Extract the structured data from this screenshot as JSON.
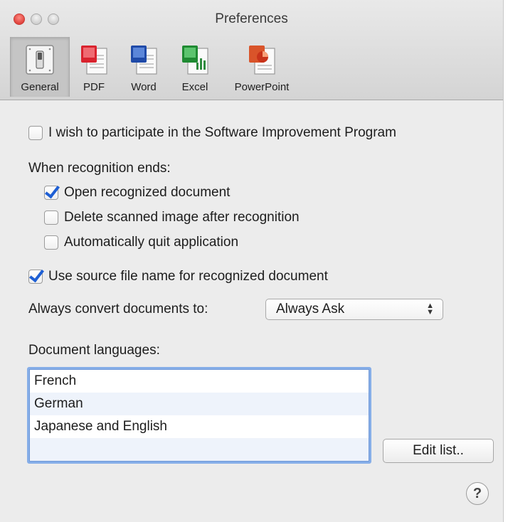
{
  "window": {
    "title": "Preferences"
  },
  "toolbar": {
    "tabs": [
      {
        "label": "General",
        "icon": "light-switch-icon",
        "selected": true
      },
      {
        "label": "PDF",
        "icon": "pdf-document-icon",
        "selected": false
      },
      {
        "label": "Word",
        "icon": "word-document-icon",
        "selected": false
      },
      {
        "label": "Excel",
        "icon": "excel-document-icon",
        "selected": false
      },
      {
        "label": "PowerPoint",
        "icon": "powerpoint-document-icon",
        "selected": false
      }
    ]
  },
  "general": {
    "improvement_program": {
      "label": "I wish to participate in the Software Improvement Program",
      "checked": false
    },
    "recognition_heading": "When recognition ends:",
    "recognition_options": [
      {
        "label": "Open recognized document",
        "checked": true
      },
      {
        "label": "Delete scanned image after recognition",
        "checked": false
      },
      {
        "label": "Automatically quit application",
        "checked": false
      }
    ],
    "use_source_name": {
      "label": "Use source file name for recognized document",
      "checked": true
    },
    "convert_label": "Always convert documents to:",
    "convert_value": "Always Ask",
    "languages_heading": "Document languages:",
    "languages": [
      "French",
      "German",
      "Japanese and English"
    ],
    "edit_list_label": "Edit list..",
    "help_label": "?"
  },
  "colors": {
    "accent": "#1e5fd4",
    "list_focus": "#86aee8",
    "close_button": "#e0443e"
  }
}
